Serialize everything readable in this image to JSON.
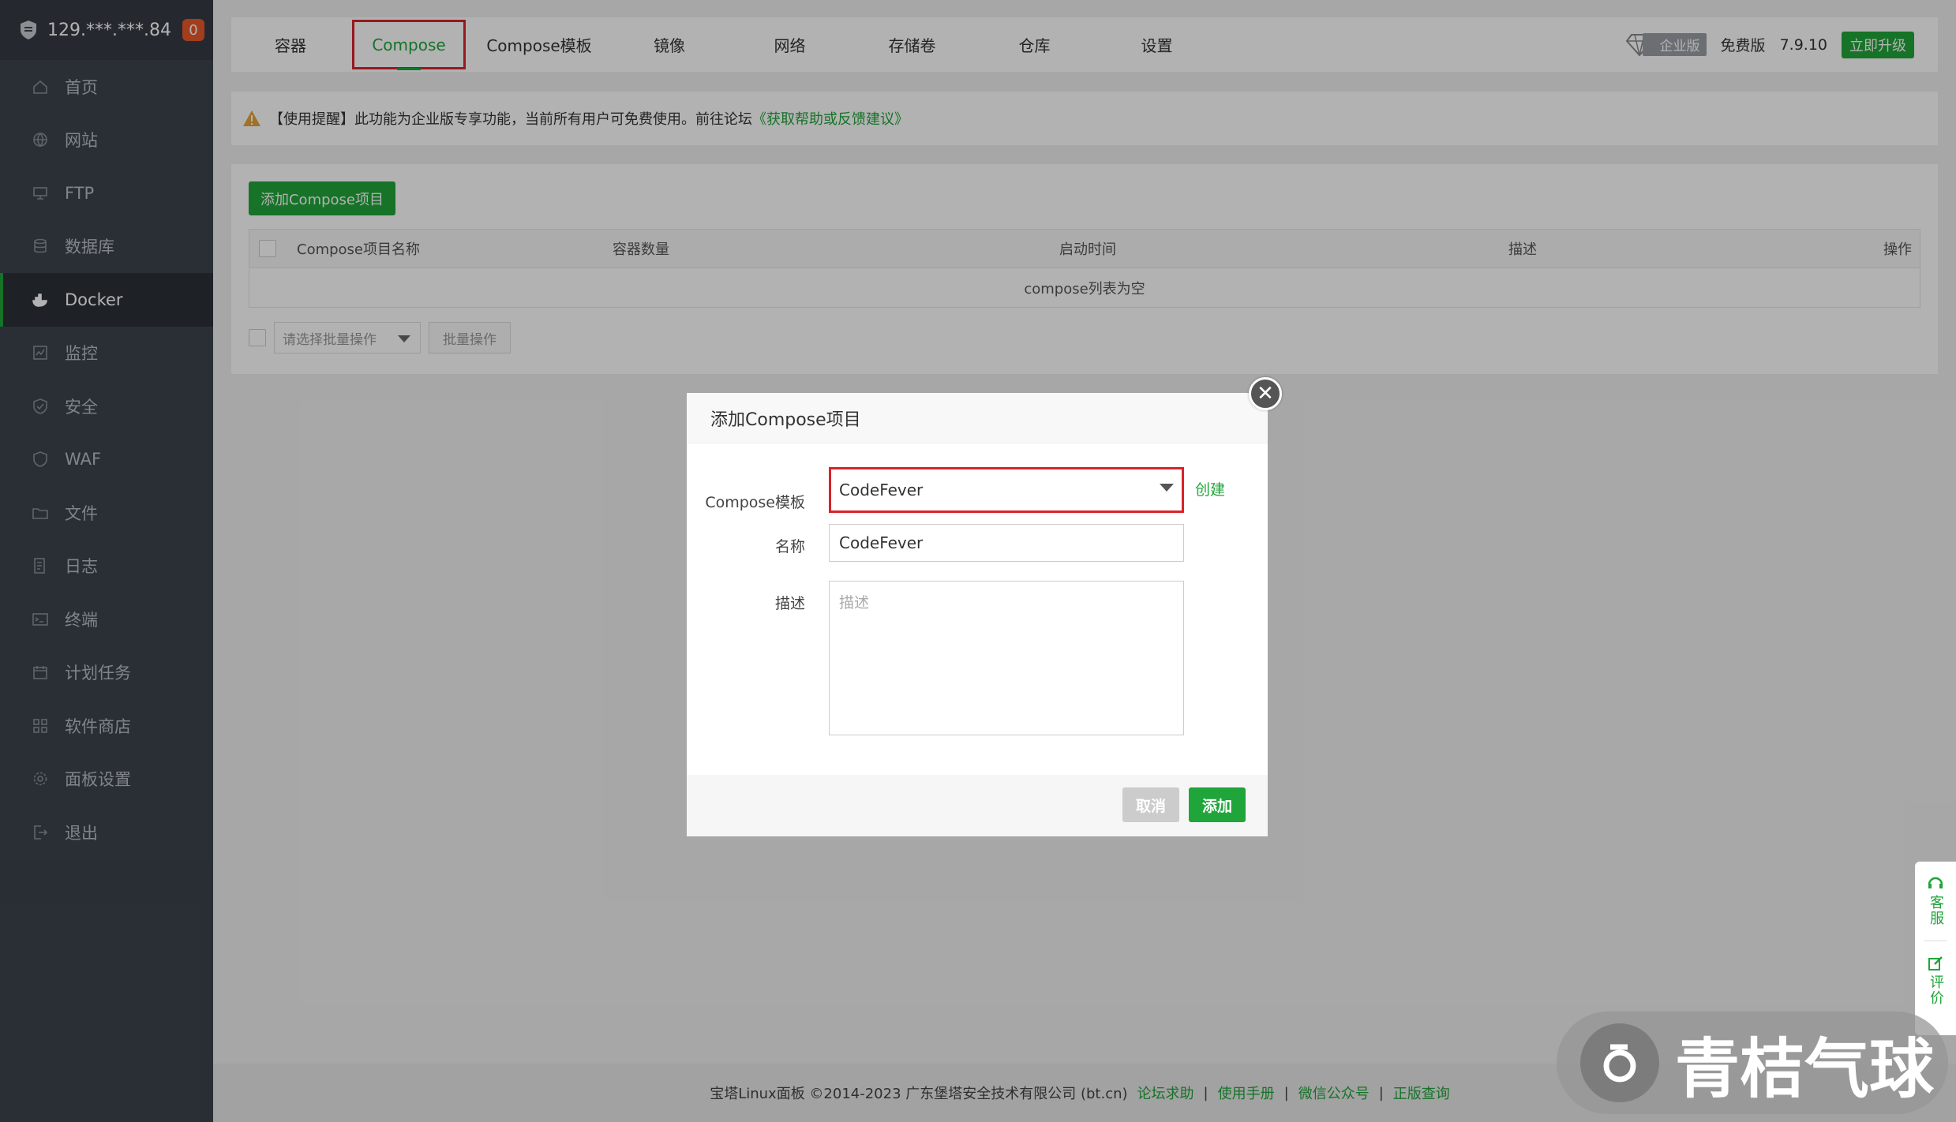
{
  "server": {
    "ip": "129.***.***.84",
    "badge": "0"
  },
  "sidebar": {
    "items": [
      {
        "label": "首页",
        "icon": "home-icon"
      },
      {
        "label": "网站",
        "icon": "globe-icon"
      },
      {
        "label": "FTP",
        "icon": "ftp-icon"
      },
      {
        "label": "数据库",
        "icon": "database-icon"
      },
      {
        "label": "Docker",
        "icon": "docker-icon",
        "active": true
      },
      {
        "label": "监控",
        "icon": "monitor-icon"
      },
      {
        "label": "安全",
        "icon": "shield-check-icon"
      },
      {
        "label": "WAF",
        "icon": "waf-shield-icon"
      },
      {
        "label": "文件",
        "icon": "folder-icon"
      },
      {
        "label": "日志",
        "icon": "log-icon"
      },
      {
        "label": "终端",
        "icon": "terminal-icon"
      },
      {
        "label": "计划任务",
        "icon": "calendar-icon"
      },
      {
        "label": "软件商店",
        "icon": "grid-icon"
      },
      {
        "label": "面板设置",
        "icon": "gear-icon"
      },
      {
        "label": "退出",
        "icon": "logout-icon"
      }
    ]
  },
  "tabs": [
    {
      "label": "容器"
    },
    {
      "label": "Compose",
      "active": true
    },
    {
      "label": "Compose模板"
    },
    {
      "label": "镜像"
    },
    {
      "label": "网络"
    },
    {
      "label": "存储卷"
    },
    {
      "label": "仓库"
    },
    {
      "label": "设置"
    }
  ],
  "topright": {
    "enterprise": "企业版",
    "edition": "免费版",
    "version": "7.9.10",
    "upgrade": "立即升级"
  },
  "alert": {
    "text": "【使用提醒】此功能为企业版专享功能，当前所有用户可免费使用。前往论坛",
    "link": "《获取帮助或反馈建议》"
  },
  "main": {
    "add_button": "添加Compose项目",
    "columns": [
      "Compose项目名称",
      "容器数量",
      "启动时间",
      "描述",
      "操作"
    ],
    "empty": "compose列表为空",
    "batch_placeholder": "请选择批量操作",
    "batch_button": "批量操作"
  },
  "modal": {
    "title": "添加Compose项目",
    "template_label": "Compose模板",
    "template_value": "CodeFever",
    "create_link": "创建",
    "name_label": "名称",
    "name_value": "CodeFever",
    "desc_label": "描述",
    "desc_placeholder": "描述",
    "cancel": "取消",
    "add": "添加"
  },
  "footer": {
    "copyright": "宝塔Linux面板 ©2014-2023 广东堡塔安全技术有限公司 (bt.cn)",
    "links": [
      "论坛求助",
      "使用手册",
      "微信公众号",
      "正版查询"
    ]
  },
  "float": {
    "service": "客服",
    "review": "评价"
  },
  "watermark": "青桔气球",
  "colors": {
    "accent": "#20a53a",
    "sidebar": "#3c444d",
    "highlight": "#d9232b"
  }
}
